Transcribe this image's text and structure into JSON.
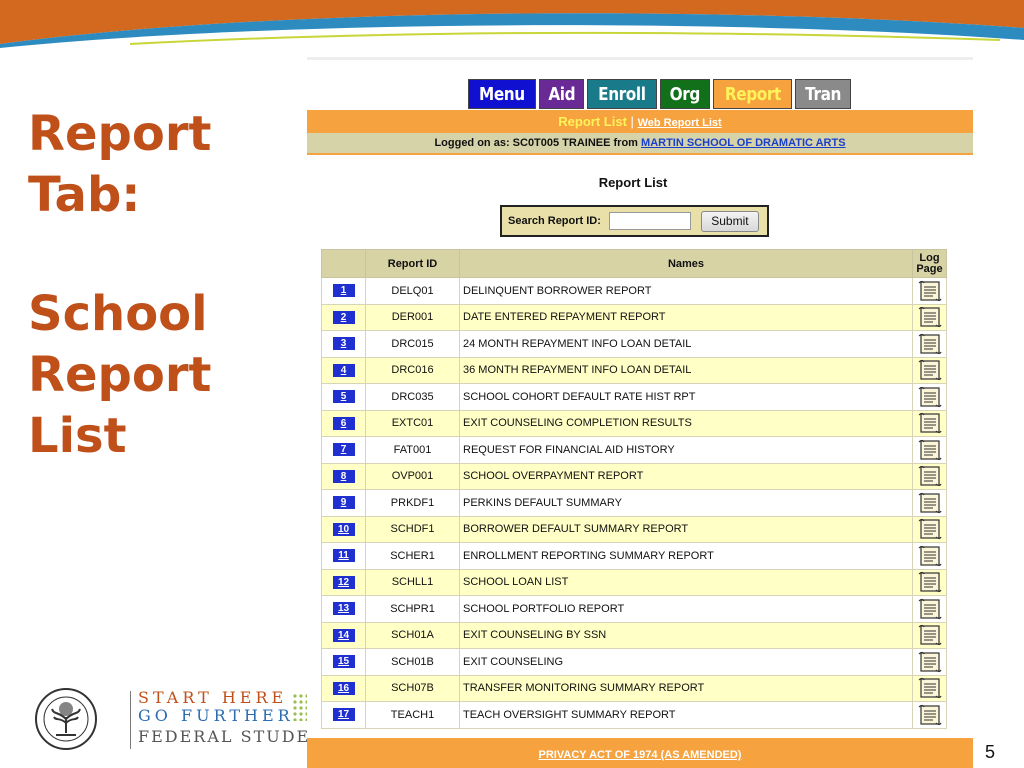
{
  "slide": {
    "title_lines": [
      "Report",
      "Tab:"
    ],
    "subtitle_lines": [
      "School",
      "Report",
      "List"
    ],
    "page_number": "5",
    "logo": {
      "line1": "START HERE",
      "line2": "GO FURTHER",
      "line3": "FEDERAL STUDENT A"
    }
  },
  "nav": {
    "tabs": [
      {
        "label": "Menu",
        "color": "#1010d0"
      },
      {
        "label": "Aid",
        "color": "#6a2a96"
      },
      {
        "label": "Enroll",
        "color": "#197a8a"
      },
      {
        "label": "Org",
        "color": "#13701a"
      },
      {
        "label": "Report",
        "color": "#f6a23e"
      },
      {
        "label": "Tran",
        "color": "#8a8a8a"
      }
    ],
    "active_tab": "Report"
  },
  "subnav": {
    "active": "Report List",
    "separator": "|",
    "link": "Web Report List"
  },
  "login": {
    "prefix": "Logged on as: SC0T005 TRAINEE from",
    "school": "MARTIN SCHOOL OF DRAMATIC ARTS"
  },
  "report_list": {
    "heading": "Report List",
    "search_label": "Search Report ID:",
    "search_value": "",
    "submit_label": "Submit",
    "columns": [
      "",
      "Report ID",
      "Names",
      "Log Page"
    ],
    "rows": [
      {
        "num": "1",
        "id": "DELQ01",
        "name": "DELINQUENT BORROWER REPORT"
      },
      {
        "num": "2",
        "id": "DER001",
        "name": "DATE ENTERED REPAYMENT REPORT"
      },
      {
        "num": "3",
        "id": "DRC015",
        "name": "24 MONTH REPAYMENT INFO LOAN DETAIL"
      },
      {
        "num": "4",
        "id": "DRC016",
        "name": "36 MONTH REPAYMENT INFO LOAN DETAIL"
      },
      {
        "num": "5",
        "id": "DRC035",
        "name": "SCHOOL COHORT DEFAULT RATE HIST RPT"
      },
      {
        "num": "6",
        "id": "EXTC01",
        "name": "EXIT COUNSELING COMPLETION RESULTS"
      },
      {
        "num": "7",
        "id": "FAT001",
        "name": "REQUEST FOR FINANCIAL AID HISTORY"
      },
      {
        "num": "8",
        "id": "OVP001",
        "name": "SCHOOL OVERPAYMENT REPORT"
      },
      {
        "num": "9",
        "id": "PRKDF1",
        "name": "PERKINS DEFAULT SUMMARY"
      },
      {
        "num": "10",
        "id": "SCHDF1",
        "name": "BORROWER DEFAULT SUMMARY REPORT"
      },
      {
        "num": "11",
        "id": "SCHER1",
        "name": "ENROLLMENT REPORTING SUMMARY REPORT"
      },
      {
        "num": "12",
        "id": "SCHLL1",
        "name": "SCHOOL LOAN LIST"
      },
      {
        "num": "13",
        "id": "SCHPR1",
        "name": "SCHOOL PORTFOLIO REPORT"
      },
      {
        "num": "14",
        "id": "SCH01A",
        "name": "EXIT COUNSELING BY SSN"
      },
      {
        "num": "15",
        "id": "SCH01B",
        "name": "EXIT COUNSELING"
      },
      {
        "num": "16",
        "id": "SCH07B",
        "name": "TRANSFER MONITORING SUMMARY REPORT"
      },
      {
        "num": "17",
        "id": "TEACH1",
        "name": "TEACH OVERSIGHT SUMMARY REPORT"
      }
    ],
    "log_icon": "scroll-icon"
  },
  "footer": {
    "link": "PRIVACY ACT OF 1974 (AS AMENDED)"
  },
  "colors": {
    "title": "#c0501a",
    "orange": "#f6a23e",
    "row_alt": "#ffffc6",
    "badge": "#1f2fd0"
  }
}
